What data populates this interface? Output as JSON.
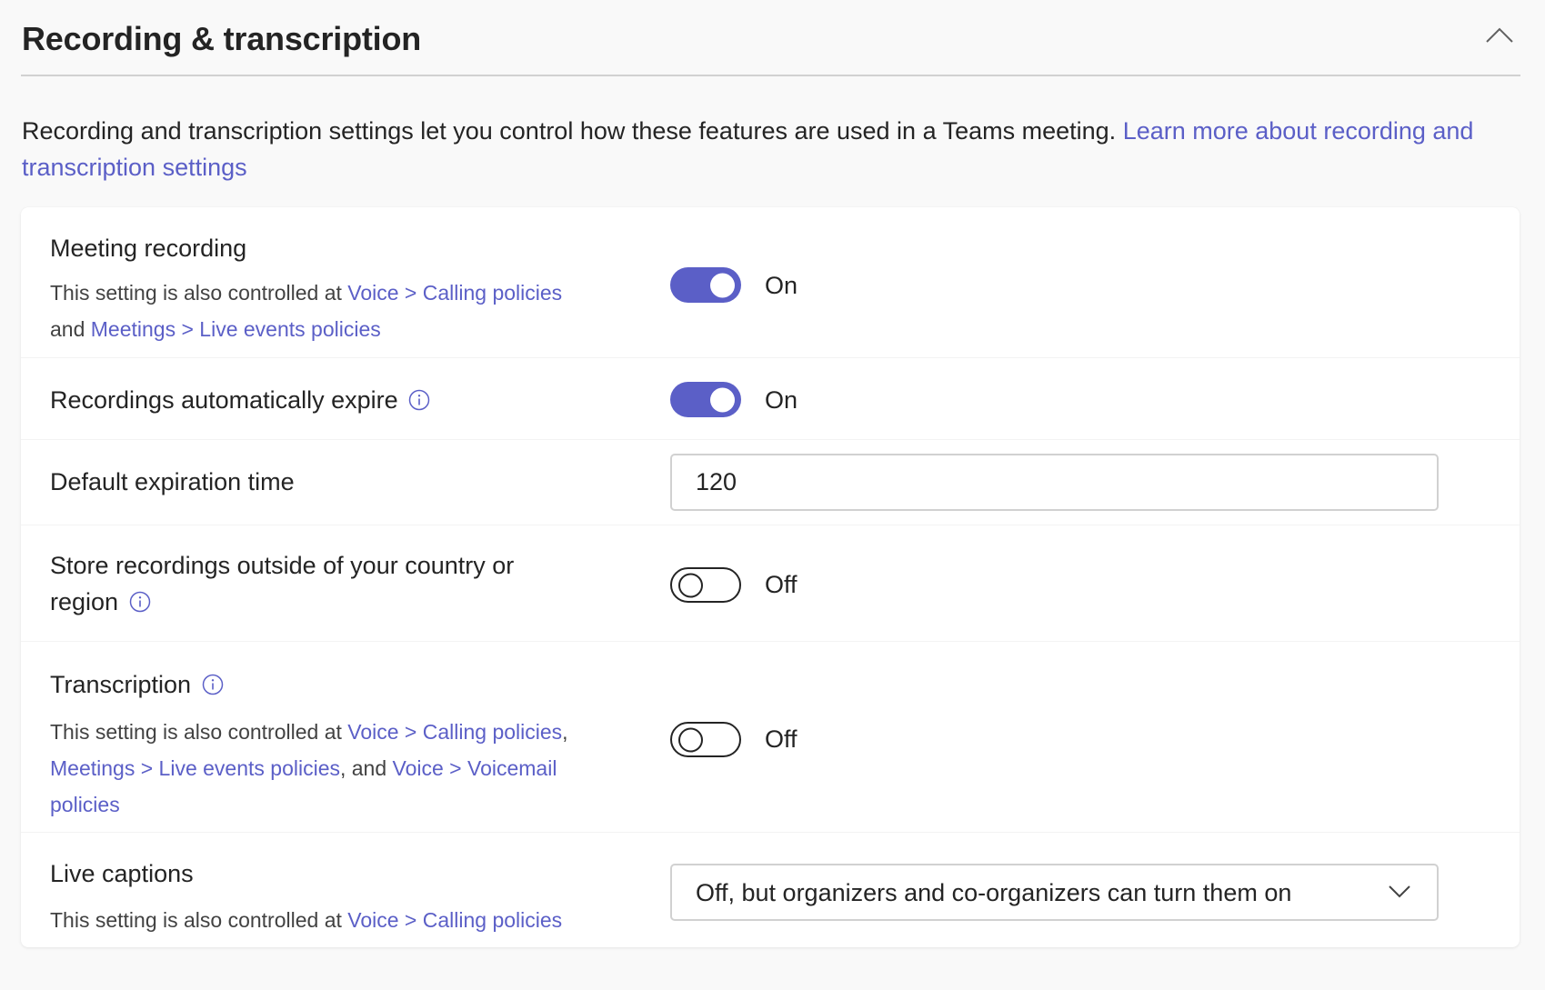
{
  "header": {
    "title": "Recording & transcription",
    "collapse_icon": "chevron-up-icon"
  },
  "description": {
    "text": "Recording and transcription settings let you control how these features are used in a Teams meeting. ",
    "link": "Learn more about recording and transcription settings"
  },
  "colors": {
    "accent": "#5b5fc7",
    "text": "#242424",
    "background": "#f9f9f9",
    "card": "#ffffff"
  },
  "settings": {
    "meeting_recording": {
      "label": "Meeting recording",
      "sub_prefix": "This setting is also controlled at ",
      "link1": "Voice > Calling policies",
      "sub_mid": "and ",
      "link2": "Meetings > Live events policies",
      "state": "On",
      "enabled": true
    },
    "auto_expire": {
      "label": "Recordings automatically expire",
      "state": "On",
      "enabled": true,
      "icon": "info-icon"
    },
    "expiration_time": {
      "label": "Default expiration time",
      "value": "120"
    },
    "store_outside": {
      "label": "Store recordings outside of your country or region",
      "state": "Off",
      "enabled": false,
      "icon": "info-icon"
    },
    "transcription": {
      "label": "Transcription",
      "sub_prefix": "This setting is also controlled at ",
      "link1": "Voice > Calling policies",
      "sep1": ",",
      "link2": "Meetings > Live events policies",
      "sep2": ", and ",
      "link3": "Voice > Voicemail policies",
      "state": "Off",
      "enabled": false,
      "icon": "info-icon"
    },
    "live_captions": {
      "label": "Live captions",
      "sub_prefix": "This setting is also controlled at ",
      "link1": "Voice > Calling policies",
      "selected": "Off, but organizers and co-organizers can turn them on"
    }
  }
}
